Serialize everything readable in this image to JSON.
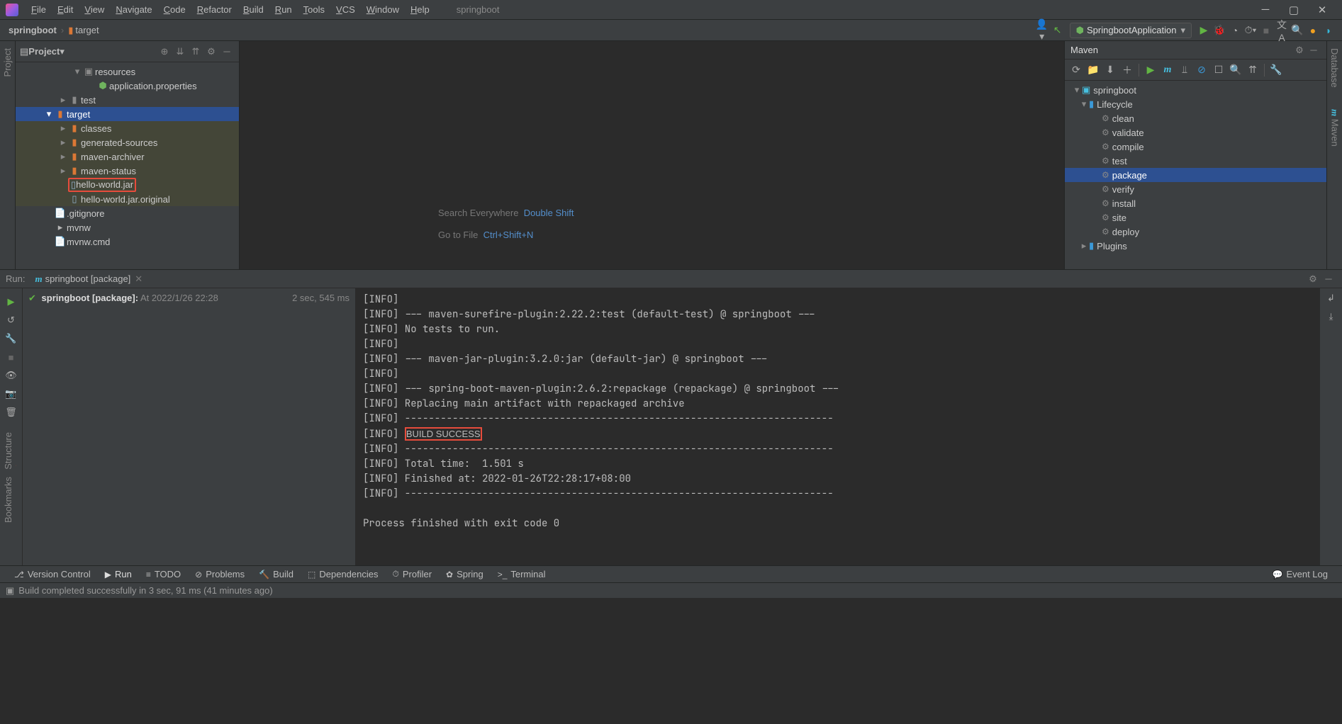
{
  "menubar": {
    "items": [
      "File",
      "Edit",
      "View",
      "Navigate",
      "Code",
      "Refactor",
      "Build",
      "Run",
      "Tools",
      "VCS",
      "Window",
      "Help"
    ],
    "project": "springboot"
  },
  "breadcrumbs": {
    "root": "springboot",
    "child": "target"
  },
  "run_config": "SpringbootApplication",
  "project_panel": {
    "title": "Project",
    "items": {
      "resources": "resources",
      "app_props": "application.properties",
      "test": "test",
      "target": "target",
      "classes": "classes",
      "gen_src": "generated-sources",
      "maven_arch": "maven-archiver",
      "maven_status": "maven-status",
      "hello_jar": "hello-world.jar",
      "hello_orig": "hello-world.jar.original",
      "gitignore": ".gitignore",
      "mvnw": "mvnw",
      "mvnwcmd": "mvnw.cmd"
    }
  },
  "editor_hints": {
    "search_label": "Search Everywhere",
    "search_key": "Double Shift",
    "goto_label": "Go to File",
    "goto_key": "Ctrl+Shift+N"
  },
  "maven": {
    "title": "Maven",
    "root": "springboot",
    "lifecycle_label": "Lifecycle",
    "goals": [
      "clean",
      "validate",
      "compile",
      "test",
      "package",
      "verify",
      "install",
      "site",
      "deploy"
    ],
    "plugins_label": "Plugins",
    "selected_goal": "package"
  },
  "run": {
    "label": "Run:",
    "tab": "springboot [package]",
    "status_bold": "springboot [package]:",
    "status_at": "At 2022/1/26 22:28",
    "duration": "2 sec, 545 ms",
    "console_lines": [
      "[INFO]",
      "[INFO] --- maven-surefire-plugin:2.22.2:test (default-test) @ springboot ---",
      "[INFO] No tests to run.",
      "[INFO]",
      "[INFO] --- maven-jar-plugin:3.2.0:jar (default-jar) @ springboot ---",
      "[INFO]",
      "[INFO] --- spring-boot-maven-plugin:2.6.2:repackage (repackage) @ springboot ---",
      "[INFO] Replacing main artifact with repackaged archive",
      "[INFO] ------------------------------------------------------------------------"
    ],
    "build_prefix": "[INFO] ",
    "build_success": "BUILD SUCCESS",
    "console_lines2": [
      "[INFO] ------------------------------------------------------------------------",
      "[INFO] Total time:  1.501 s",
      "[INFO] Finished at: 2022-01-26T22:28:17+08:00",
      "[INFO] ------------------------------------------------------------------------",
      "",
      "Process finished with exit code 0"
    ]
  },
  "bottom": {
    "tabs": [
      "Version Control",
      "Run",
      "TODO",
      "Problems",
      "Build",
      "Dependencies",
      "Profiler",
      "Spring",
      "Terminal"
    ],
    "event_log": "Event Log"
  },
  "status": "Build completed successfully in 3 sec, 91 ms (41 minutes ago)",
  "left_tabs": {
    "project": "Project",
    "structure": "Structure",
    "bookmarks": "Bookmarks"
  },
  "right_tabs": {
    "database": "Database",
    "maven": "Maven"
  }
}
